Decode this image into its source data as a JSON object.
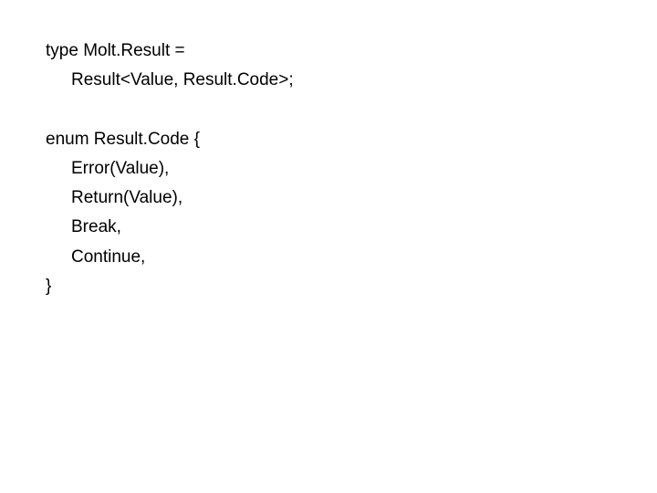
{
  "lines": {
    "l1": "type Molt.Result =",
    "l2": "Result<Value, Result.Code>;",
    "l3": "enum Result.Code {",
    "l4": "Error(Value),",
    "l5": "Return(Value),",
    "l6": "Break,",
    "l7": "Continue,",
    "l8": "}"
  }
}
